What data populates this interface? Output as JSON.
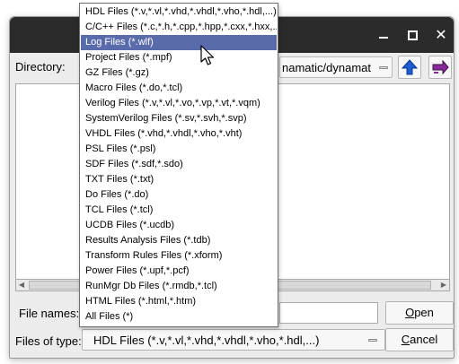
{
  "window": {
    "title": ""
  },
  "titlebar": {
    "minimize_icon": "minimize-icon",
    "maximize_icon": "maximize-icon",
    "close_icon": "close-icon"
  },
  "toolbar": {
    "directory_label": "Directory:",
    "directory_value": "namatic/dynamat",
    "up_icon": "up-arrow-icon",
    "forward_icon": "next-folder-icon",
    "accent_blue": "#1e5ccf",
    "accent_purple": "#8a2a9a"
  },
  "filetype_menu": {
    "selected_index": 2,
    "highlight_color": "#5a6bab",
    "items": [
      "HDL Files (*.v,*.vl,*.vhd,*.vhdl,*.vho,*.hdl,...)",
      "C/C++ Files (*.c,*.h,*.cpp,*.hpp,*.cxx,*.hxx,...)",
      "Log Files (*.wlf)",
      "Project Files (*.mpf)",
      "GZ Files (*.gz)",
      "Macro Files (*.do,*.tcl)",
      "Verilog Files (*.v,*.vl,*.vo,*.vp,*.vt,*.vqm)",
      "SystemVerilog Files (*.sv,*.svh,*.svp)",
      "VHDL Files (*.vhd,*.vhdl,*.vho,*.vht)",
      "PSL Files (*.psl)",
      "SDF Files (*.sdf,*.sdo)",
      "TXT Files (*.txt)",
      "Do Files (*.do)",
      "TCL Files (*.tcl)",
      "UCDB Files (*.ucdb)",
      "Results Analysis Files (*.tdb)",
      "Transform Rules Files (*.xform)",
      "Power Files (*.upf,*.pcf)",
      "RunMgr Db Files (*.rmdb,*.tcl)",
      "HTML Files (*.html,*.htm)",
      "All Files (*)"
    ]
  },
  "filename": {
    "label": "File names:",
    "value": ""
  },
  "filetype": {
    "label": "Files of type:",
    "value": "HDL Files (*.v,*.vl,*.vhd,*.vhdl,*.vho,*.hdl,...)"
  },
  "buttons": {
    "open": "Open",
    "cancel": "Cancel"
  }
}
